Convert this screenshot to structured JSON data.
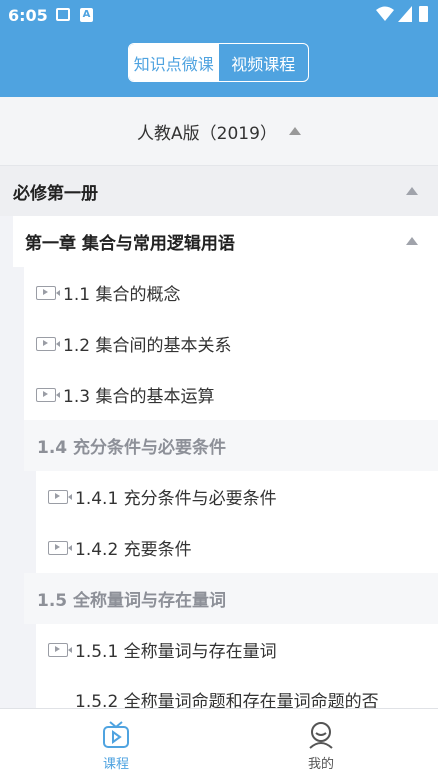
{
  "status_bar": {
    "time": "6:05",
    "colors": {
      "bg": "#4fa3e0"
    }
  },
  "header": {
    "tabs": [
      {
        "label": "知识点微课",
        "active": true
      },
      {
        "label": "视频课程",
        "active": false
      }
    ]
  },
  "version": {
    "label": "人教A版（2019）"
  },
  "book": {
    "title": "必修第一册"
  },
  "chapter": {
    "title": "第一章 集合与常用逻辑用语"
  },
  "items": [
    {
      "type": "lesson",
      "label": "1.1 集合的概念"
    },
    {
      "type": "lesson",
      "label": "1.2 集合间的基本关系"
    },
    {
      "type": "lesson",
      "label": "1.3 集合的基本运算"
    },
    {
      "type": "section",
      "label": "1.4 充分条件与必要条件"
    },
    {
      "type": "sublesson",
      "label": "1.4.1 充分条件与必要条件"
    },
    {
      "type": "sublesson",
      "label": "1.4.2 充要条件"
    },
    {
      "type": "section",
      "label": "1.5 全称量词与存在量词"
    },
    {
      "type": "sublesson",
      "label": "1.5.1 全称量词与存在量词"
    },
    {
      "type": "sublesson",
      "label": "1.5.2 全称量词命题和存在量词命题的否"
    }
  ],
  "tabbar": {
    "tabs": [
      {
        "label": "课程",
        "icon": "tv-icon",
        "active": true,
        "color": "#4fa3e0"
      },
      {
        "label": "我的",
        "icon": "user-icon",
        "active": false,
        "color": "#666666"
      }
    ]
  }
}
